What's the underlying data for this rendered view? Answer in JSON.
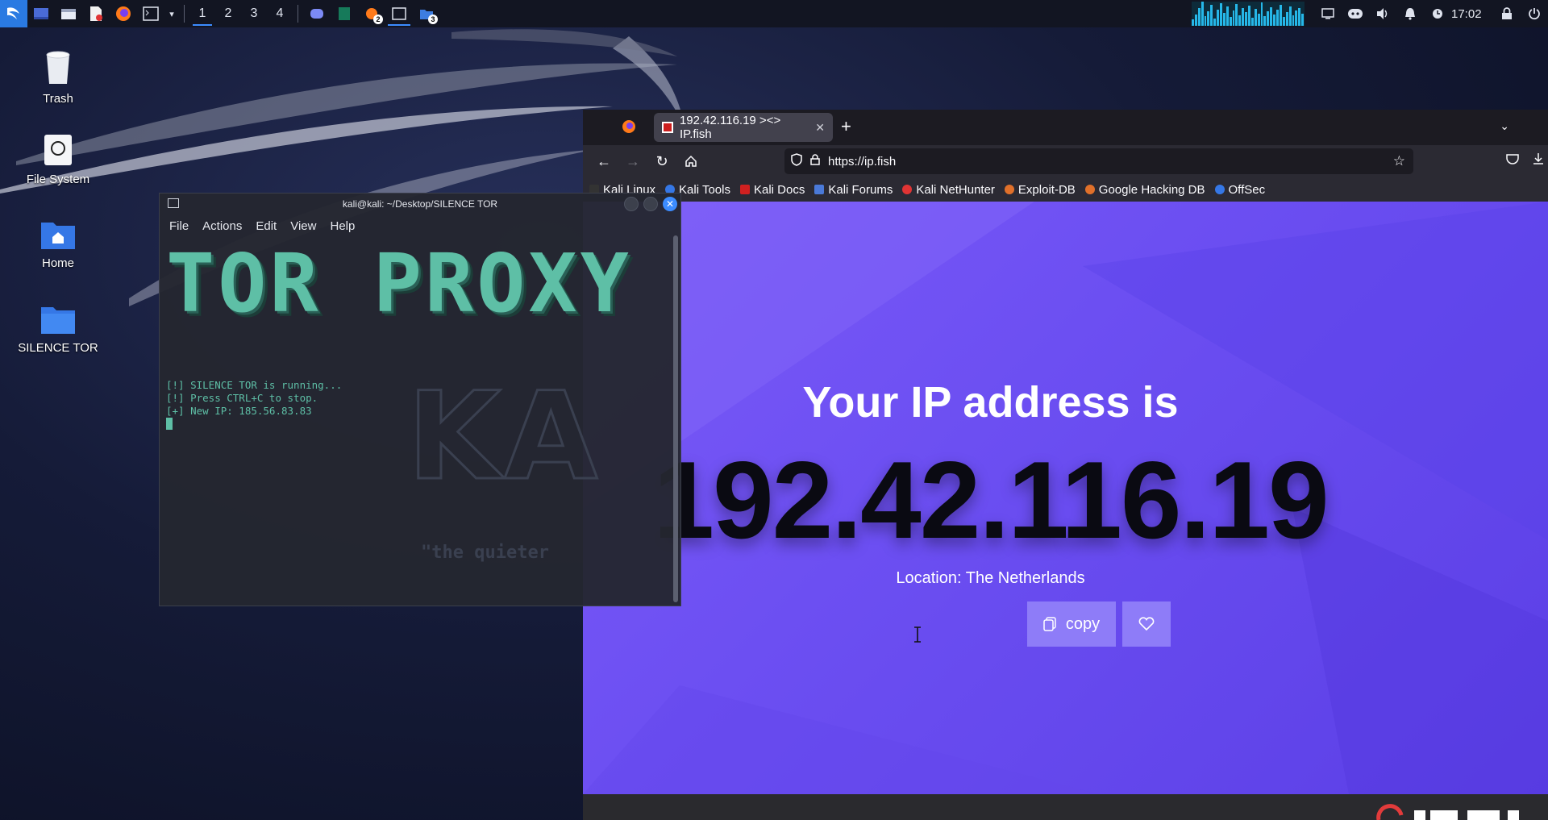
{
  "panel": {
    "workspaces": [
      "1",
      "2",
      "3",
      "4"
    ],
    "active_workspace": "1",
    "task_badges": [
      "2",
      "3"
    ],
    "clock": "17:02"
  },
  "desktop": {
    "icons": [
      {
        "label": "Trash"
      },
      {
        "label": "File System"
      },
      {
        "label": "Home"
      },
      {
        "label": "SILENCE TOR"
      }
    ]
  },
  "terminal": {
    "title": "kali@kali: ~/Desktop/SILENCE TOR",
    "menu": [
      "File",
      "Actions",
      "Edit",
      "View",
      "Help"
    ],
    "banner": "TOR PROXY",
    "lines": [
      "[!] SILENCE TOR is running...",
      "[!] Press CTRL+C to stop.",
      "[+] New IP: 185.56.83.83"
    ],
    "watermark": "KA",
    "watermark_sub": "\"the quieter"
  },
  "browser": {
    "tab_title": "192.42.116.19 ><> IP.fish",
    "url": "https://ip.fish",
    "bookmarks": [
      "Kali Linux",
      "Kali Tools",
      "Kali Docs",
      "Kali Forums",
      "Kali NetHunter",
      "Exploit-DB",
      "Google Hacking DB",
      "OffSec"
    ],
    "page": {
      "heading": "Your IP address is",
      "ip": "192.42.116.19",
      "location": "Location: The Netherlands",
      "copy_label": "copy"
    }
  },
  "colors": {
    "page_bg": "#6c4ff2",
    "terminal_text": "#5ebfa6",
    "accent": "#3c8cff"
  }
}
